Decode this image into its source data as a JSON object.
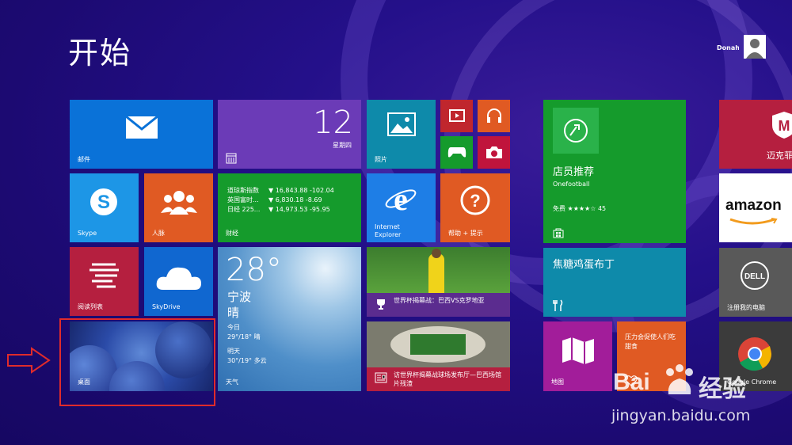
{
  "screen": {
    "title": "开始",
    "username": "Donah"
  },
  "tiles": {
    "mail": {
      "label": "邮件",
      "color": "#0a72d8"
    },
    "calendar": {
      "day": "12",
      "weekday": "星期四",
      "color": "#6b3bb7"
    },
    "photos": {
      "label": "照片",
      "color": "#0e8aaa"
    },
    "video": {
      "color": "#c0262d"
    },
    "music": {
      "color": "#e05a23"
    },
    "games": {
      "color": "#159b2c"
    },
    "camera": {
      "color": "#c0143c"
    },
    "skype": {
      "label": "Skype",
      "color": "#1d96e6"
    },
    "people": {
      "label": "人脉",
      "color": "#e05a23"
    },
    "finance": {
      "label": "财经",
      "color": "#159b2c",
      "rows": [
        {
          "name": "道琼斯指数",
          "value": "▼ 16,843.88 -102.04"
        },
        {
          "name": "英国富时...",
          "value": "▼ 6,830.18 -8.69"
        },
        {
          "name": "日经 225...",
          "value": "▼ 14,973.53 -95.95"
        }
      ]
    },
    "ie": {
      "label": "Internet Explorer",
      "color": "#1e7ee6"
    },
    "help": {
      "label": "帮助 + 提示",
      "color": "#e05a23"
    },
    "reading": {
      "label": "阅读列表",
      "color": "#b51f3f"
    },
    "skydrive": {
      "label": "SkyDrive",
      "color": "#1067d0"
    },
    "weather": {
      "temp": "28°",
      "city": "宁波",
      "cond": "晴",
      "today_label": "今日",
      "today": "29°/18° 晴",
      "tomorrow_label": "明天",
      "tomorrow": "30°/19° 多云",
      "label": "天气"
    },
    "sports": {
      "caption": "世界杯揭幕战：巴西VS克罗地亚",
      "color": "#5b2c8f"
    },
    "news": {
      "caption": "访世界杯揭幕战球场发布厅—巴西场馆",
      "caption2": "片残渣",
      "color": "#b51f3f"
    },
    "desktop": {
      "label": "桌面"
    },
    "store": {
      "title": "店员推荐",
      "app": "Onefootball",
      "rating": "免费 ★★★★☆ 45",
      "color": "#159b2c"
    },
    "recipe": {
      "title": "焦糖鸡蛋布丁",
      "color": "#0e8aaa"
    },
    "maps": {
      "label": "地图",
      "color": "#a21d9a"
    },
    "health": {
      "text": "压力会促使人们吃甜食",
      "color": "#e05a23"
    },
    "mcafee": {
      "label": "迈克菲",
      "color": "#b51f3f"
    },
    "amazon": {
      "label": "amazon"
    },
    "dell": {
      "label": "注册我的电脑"
    },
    "chrome": {
      "label": "Google Chrome"
    }
  },
  "watermark": {
    "brand": "Bai",
    "brand2": "经验",
    "url": "jingyan.baidu.com"
  }
}
